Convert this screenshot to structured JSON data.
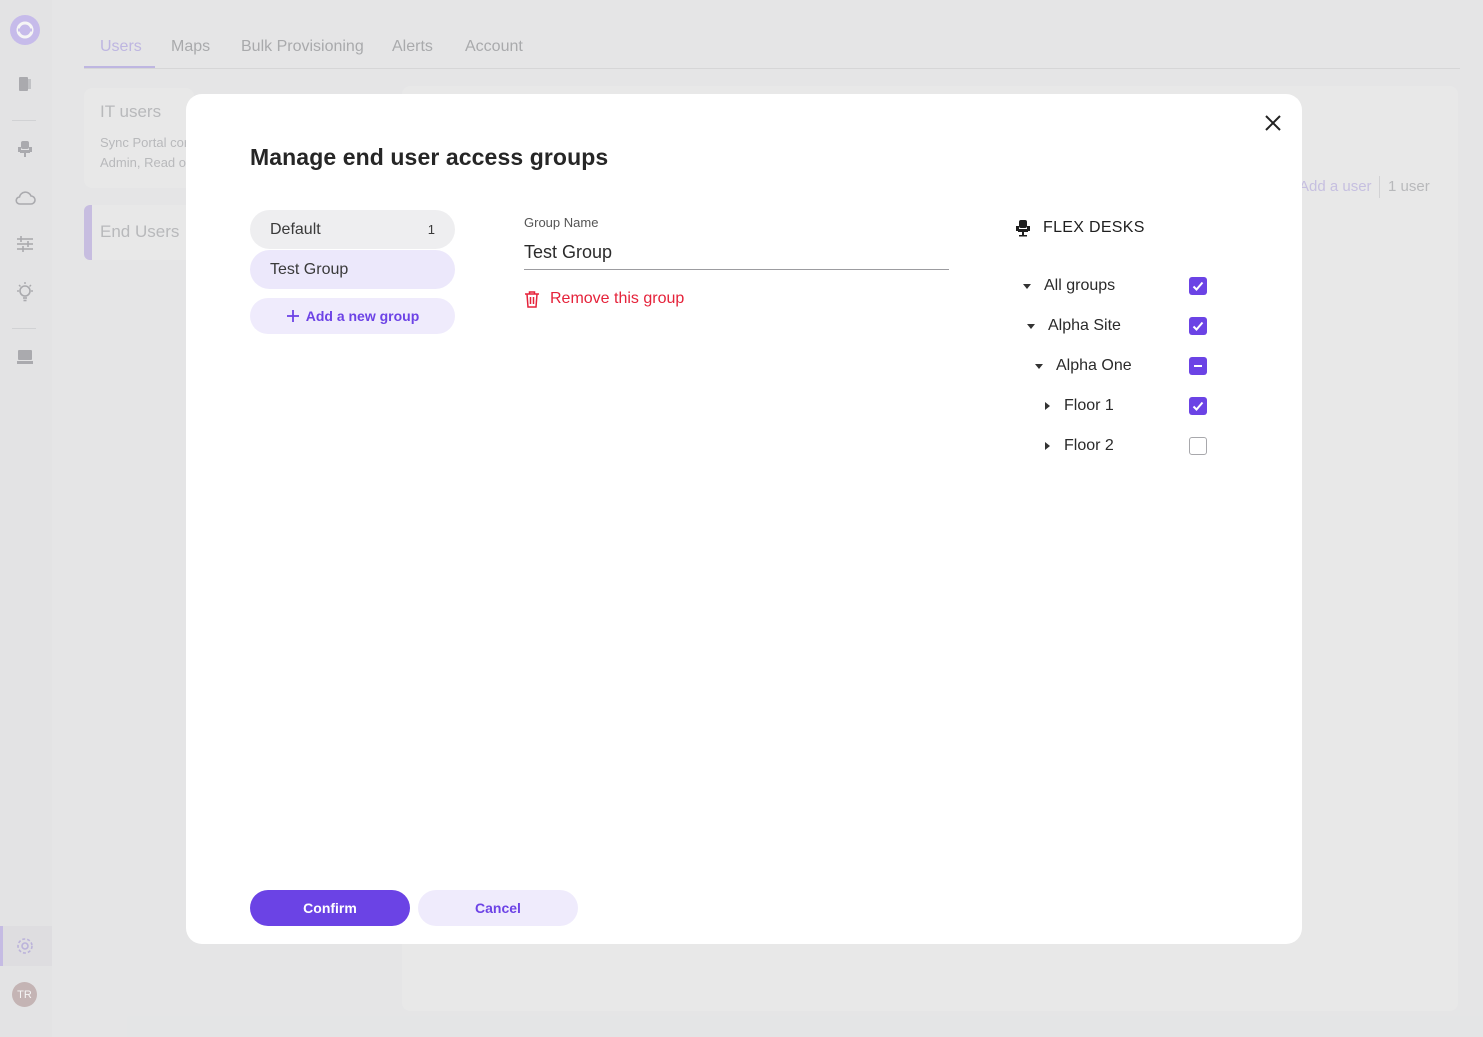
{
  "nav": {
    "tabs": [
      {
        "label": "Users"
      },
      {
        "label": "Maps"
      },
      {
        "label": "Bulk Provisioning"
      },
      {
        "label": "Alerts"
      },
      {
        "label": "Account"
      }
    ]
  },
  "background": {
    "it_users": {
      "title": "IT users",
      "desc_line1": "Sync Portal cor",
      "desc_line2": "Admin, Read o"
    },
    "end_users": {
      "title": "End Users"
    },
    "add_user": "Add a user",
    "user_count": "1 user"
  },
  "sidebar": {
    "avatar_initials": "TR"
  },
  "modal": {
    "title": "Manage end user access groups",
    "groups": [
      {
        "label": "Default",
        "count": "1"
      },
      {
        "label": "Test Group",
        "count": ""
      }
    ],
    "add_group_label": "Add a new group",
    "field_label": "Group Name",
    "field_value": "Test Group",
    "remove_label": "Remove this group",
    "section_title": "FLEX DESKS",
    "tree": [
      {
        "label": "All groups",
        "state": "checked",
        "expanded": true
      },
      {
        "label": "Alpha Site",
        "state": "checked",
        "expanded": true
      },
      {
        "label": "Alpha One",
        "state": "partial",
        "expanded": true
      },
      {
        "label": "Floor 1",
        "state": "checked",
        "expanded": false
      },
      {
        "label": "Floor 2",
        "state": "unchecked",
        "expanded": false
      }
    ],
    "confirm_label": "Confirm",
    "cancel_label": "Cancel"
  },
  "colors": {
    "primary": "#6b43e5",
    "danger": "#e5223a",
    "primary_soft": "#efebfc"
  }
}
